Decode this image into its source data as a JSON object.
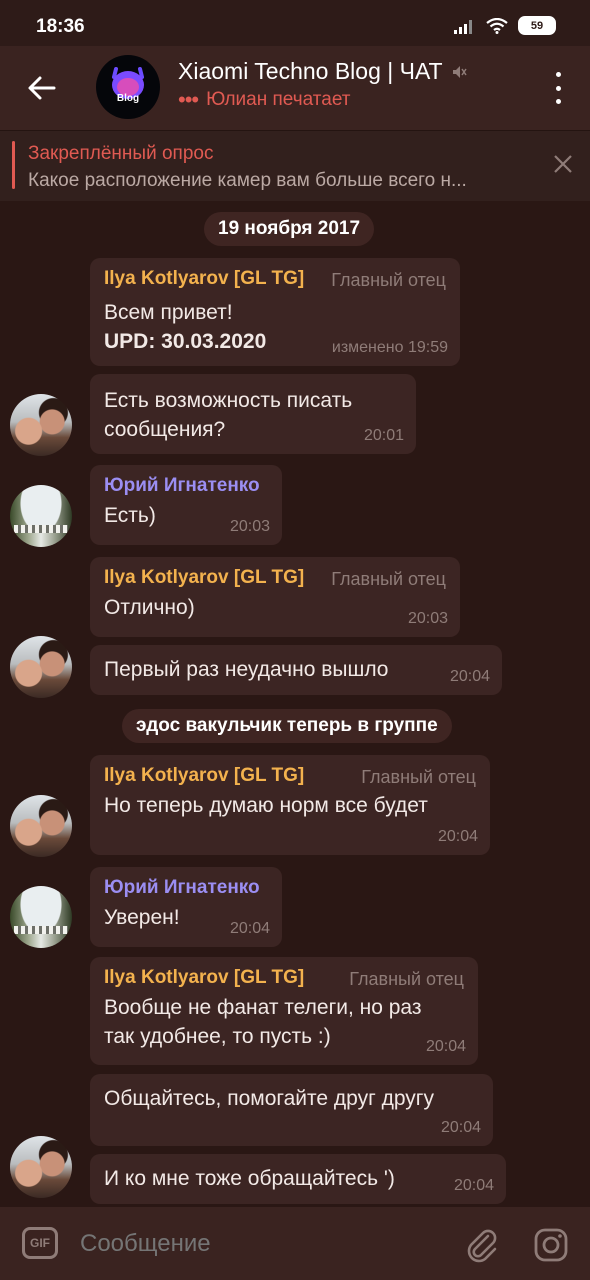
{
  "status_bar": {
    "time": "18:36",
    "battery": "59"
  },
  "header": {
    "avatar_text": "Blog",
    "title": "Xiaomi Techno Blog | ЧАТ",
    "typing_dots": "•••",
    "status": "Юлиан печатает"
  },
  "pinned": {
    "title": "Закреплённый опрос",
    "text": "Какое расположение камер вам больше всего н..."
  },
  "date_pill": "19 ноября 2017",
  "messages": [
    {
      "sender": "Ilya Kotlyarov [GL TG]",
      "role": "Главный отец",
      "lines": [
        "Всем привет!",
        "UPD: 30.03.2020"
      ],
      "meta": "изменено 19:59"
    },
    {
      "lines": [
        "Есть возможность писать",
        "сообщения?"
      ],
      "meta": "20:01"
    },
    {
      "sender": "Юрий Игнатенко",
      "lines": [
        "Есть)"
      ],
      "meta": "20:03"
    },
    {
      "sender": "Ilya Kotlyarov [GL TG]",
      "role": "Главный отец",
      "lines": [
        "Отлично)"
      ],
      "meta": "20:03"
    },
    {
      "lines": [
        "Первый раз неудачно вышло"
      ],
      "meta": "20:04"
    },
    {
      "sender": "Ilya Kotlyarov [GL TG]",
      "role": "Главный отец",
      "lines": [
        "Но теперь думаю норм все будет"
      ],
      "meta": "20:04"
    },
    {
      "sender": "Юрий Игнатенко",
      "lines": [
        "Уверен!"
      ],
      "meta": "20:04"
    },
    {
      "sender": "Ilya Kotlyarov [GL TG]",
      "role": "Главный отец",
      "lines": [
        "Вообще не фанат телеги, но раз",
        "так удобнее, то пусть :)"
      ],
      "meta": "20:04"
    },
    {
      "lines": [
        "Общайтесь, помогайте друг другу"
      ],
      "meta": "20:04"
    },
    {
      "lines": [
        "И ко мне тоже обращайтесь ')"
      ],
      "meta": "20:04"
    }
  ],
  "service_pill": "эдос вакульчик теперь в группе",
  "input": {
    "gif_label": "GIF",
    "placeholder": "Сообщение"
  },
  "colors": {
    "background": "#2a1714",
    "bubble": "#3c2523",
    "accent_red": "#e05a52",
    "sender_yellow": "#f3b24e",
    "sender_purple": "#9b8ef2"
  }
}
